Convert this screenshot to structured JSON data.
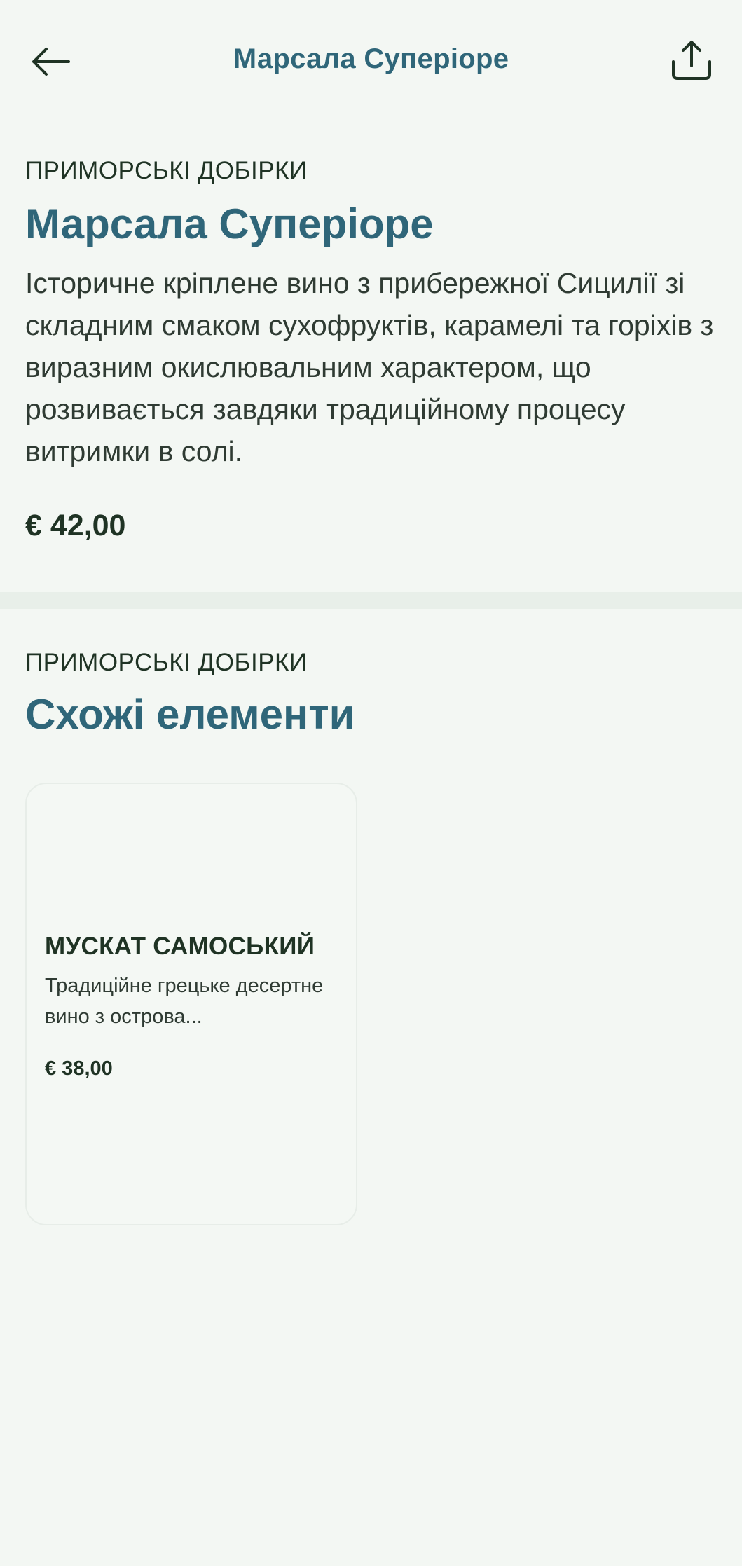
{
  "header": {
    "title": "Марсала Супеpiоре",
    "back_icon": "arrow-left-icon",
    "share_icon": "share-icon"
  },
  "product": {
    "category": "ПРИМОРСЬКІ ДОБІРКИ",
    "name": "Марсала Супеpiоре",
    "description": "Історичне кріплене вино з прибережної Сицилії зі складним смаком сухофруктів, карамелі та горіхів з виразним окислювальним характером, що розвивається завдяки традиційному процесу витримки в солі.",
    "price": "€ 42,00"
  },
  "similar": {
    "category": "ПРИМОРСЬКІ ДОБІРКИ",
    "title": "Схожі елементи",
    "items": [
      {
        "name": "МУСКАТ САМОСЬКИЙ",
        "description": "Традиційне грецьке десертне вино з острова...",
        "price": "€ 38,00"
      }
    ]
  },
  "colors": {
    "background": "#f3f7f3",
    "accent": "#2f6679",
    "text": "#1f3324"
  }
}
